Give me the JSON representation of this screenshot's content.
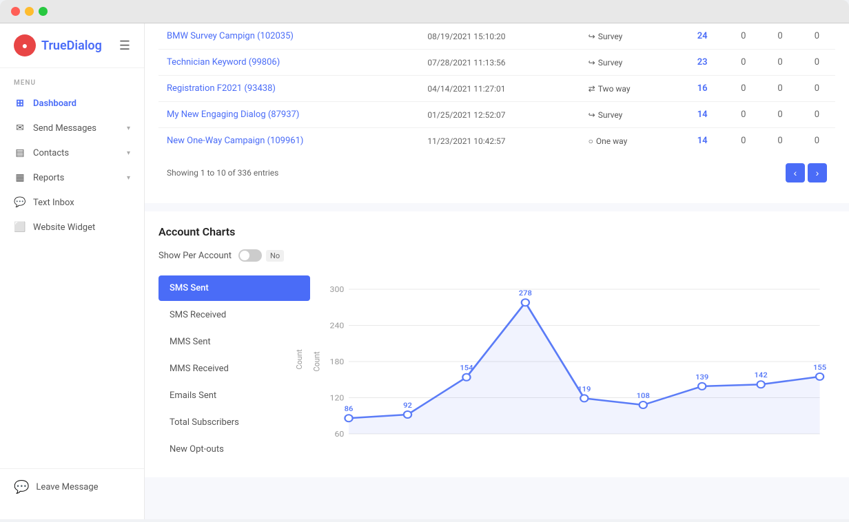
{
  "app": {
    "title": "TrueDialog",
    "logo_text_plain": "True",
    "logo_text_accent": "Dialog"
  },
  "window": {
    "chrome": {
      "close": "close",
      "minimize": "minimize",
      "maximize": "maximize"
    }
  },
  "sidebar": {
    "menu_label": "MENU",
    "items": [
      {
        "id": "dashboard",
        "label": "Dashboard",
        "icon": "⊞",
        "active": true,
        "has_arrow": false
      },
      {
        "id": "send-messages",
        "label": "Send Messages",
        "icon": "✉",
        "active": false,
        "has_arrow": true
      },
      {
        "id": "contacts",
        "label": "Contacts",
        "icon": "☰",
        "active": false,
        "has_arrow": true
      },
      {
        "id": "reports",
        "label": "Reports",
        "icon": "📊",
        "active": false,
        "has_arrow": true
      },
      {
        "id": "text-inbox",
        "label": "Text Inbox",
        "icon": "💬",
        "active": false,
        "has_arrow": false
      },
      {
        "id": "website-widget",
        "label": "Website Widget",
        "icon": "⬜",
        "active": false,
        "has_arrow": false
      }
    ],
    "leave_message": "Leave Message"
  },
  "table": {
    "rows": [
      {
        "campaign": "BMW Survey Campign (102035)",
        "date": "08/19/2021 15:10:20",
        "type": "Survey",
        "type_icon": "↪",
        "count": "24",
        "c2": "0",
        "c3": "0",
        "c4": "0"
      },
      {
        "campaign": "Technician Keyword (99806)",
        "date": "07/28/2021 11:13:56",
        "type": "Survey",
        "type_icon": "↪",
        "count": "23",
        "c2": "0",
        "c3": "0",
        "c4": "0"
      },
      {
        "campaign": "Registration F2021 (93438)",
        "date": "04/14/2021 11:27:01",
        "type": "Two way",
        "type_icon": "⇄",
        "count": "16",
        "c2": "0",
        "c3": "0",
        "c4": "0"
      },
      {
        "campaign": "My New Engaging Dialog (87937)",
        "date": "01/25/2021 12:52:07",
        "type": "Survey",
        "type_icon": "↪",
        "count": "14",
        "c2": "0",
        "c3": "0",
        "c4": "0"
      },
      {
        "campaign": "New One-Way Campaign (109961)",
        "date": "11/23/2021 10:42:57",
        "type": "One way",
        "type_icon": "○",
        "count": "14",
        "c2": "0",
        "c3": "0",
        "c4": "0"
      }
    ],
    "footer": "Showing 1 to 10 of 336 entries"
  },
  "charts": {
    "title": "Account Charts",
    "show_per_account_label": "Show Per Account",
    "toggle_label": "No",
    "menu_items": [
      {
        "id": "sms-sent",
        "label": "SMS Sent",
        "active": true
      },
      {
        "id": "sms-received",
        "label": "SMS Received",
        "active": false
      },
      {
        "id": "mms-sent",
        "label": "MMS Sent",
        "active": false
      },
      {
        "id": "mms-received",
        "label": "MMS Received",
        "active": false
      },
      {
        "id": "emails-sent",
        "label": "Emails Sent",
        "active": false
      },
      {
        "id": "total-subscribers",
        "label": "Total Subscribers",
        "active": false
      },
      {
        "id": "new-opt-outs",
        "label": "New Opt-outs",
        "active": false
      }
    ],
    "chart": {
      "y_label": "Count",
      "y_max": 300,
      "y_min": 60,
      "y_ticks": [
        300,
        240,
        180,
        120,
        60
      ],
      "data_points": [
        {
          "x": 0,
          "y": 86,
          "label": "86"
        },
        {
          "x": 1,
          "y": 92,
          "label": "92"
        },
        {
          "x": 2,
          "y": 154,
          "label": "154"
        },
        {
          "x": 3,
          "y": 278,
          "label": "278"
        },
        {
          "x": 4,
          "y": 119,
          "label": "119"
        },
        {
          "x": 5,
          "y": 108,
          "label": "108"
        },
        {
          "x": 6,
          "y": 139,
          "label": "139"
        },
        {
          "x": 7,
          "y": 142,
          "label": "142"
        },
        {
          "x": 8,
          "y": 155,
          "label": "155"
        }
      ]
    }
  }
}
